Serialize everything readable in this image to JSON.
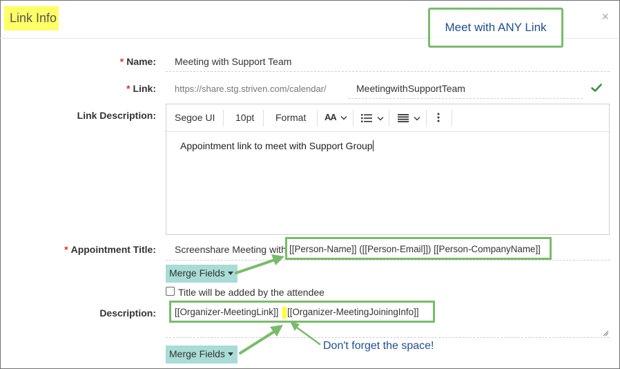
{
  "dialog": {
    "title": "Link Info",
    "close_glyph": "×"
  },
  "callout_top": {
    "text": "Meet with ANY Link"
  },
  "fields": {
    "required_marker": "*",
    "name": {
      "label": "Name:",
      "value": "Meeting with Support Team"
    },
    "link": {
      "label": "Link:",
      "prefix": "https://share.stg.striven.com/calendar/",
      "value": "MeetingwithSupportTeam",
      "status_icon": "checkmark-icon"
    },
    "link_description": {
      "label": "Link Description:",
      "toolbar": {
        "font": "Segoe UI",
        "size": "10pt",
        "format": "Format",
        "text_size_glyph": "AA",
        "list_icon": "bulleted-list-icon",
        "align_icon": "align-icon",
        "more_icon": "more-vertical-icon"
      },
      "content": "Appointment link to meet with Support Group"
    },
    "appointment_title": {
      "label": "Appointment Title:",
      "value_prefix": "Screenshare Meeting with ",
      "value_merge": "[[Person-Name]] ([[Person-Email]]) [[Person-CompanyName]]"
    },
    "merge_fields_label": "Merge Fields",
    "attendee_checkbox": {
      "label": "Title will be added by the attendee",
      "checked": false
    },
    "description": {
      "label": "Description:",
      "value_part1": "[[Organizer-MeetingLink]]",
      "value_part2": "[[Organizer-MeetingJoiningInfo]]"
    }
  },
  "annotations": {
    "space_note": "Don't forget the space!",
    "accent_green": "#79bb6b",
    "note_blue": "#1f4e8c",
    "highlight_yellow": "#ffff66"
  }
}
